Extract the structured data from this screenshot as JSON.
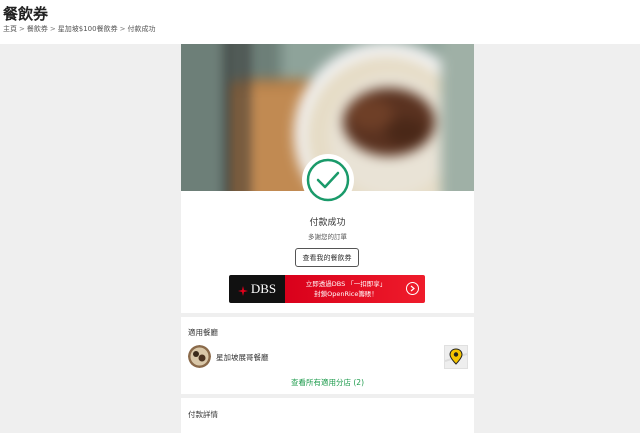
{
  "header": {
    "title": "餐飲券",
    "breadcrumb": [
      "主頁",
      "餐飲券",
      "星加坡$100餐飲券",
      "付款成功"
    ]
  },
  "payment": {
    "title": "付款成功",
    "subtitle": "多謝您的訂單",
    "view_button": "查看我的餐飲券"
  },
  "banner": {
    "brand": "DBS",
    "line1": "立即透過DBS 「一扣即享」",
    "line2": "封鎖OpenRice籌賬！"
  },
  "restaurants": {
    "section_title": "適用餐廳",
    "name": "星加坡展哥餐廳",
    "all_branches_link": "查看所有適用分店 (2)"
  },
  "payment_details": {
    "section_title": "付款詳情"
  },
  "colors": {
    "accent_green": "#1a9a4a",
    "banner_red": "#d9001b",
    "banner_dark": "#111111"
  },
  "icons": {
    "check": "check-circle-icon",
    "arrow": "chevron-right-circle-icon",
    "map": "map-pin-icon"
  }
}
